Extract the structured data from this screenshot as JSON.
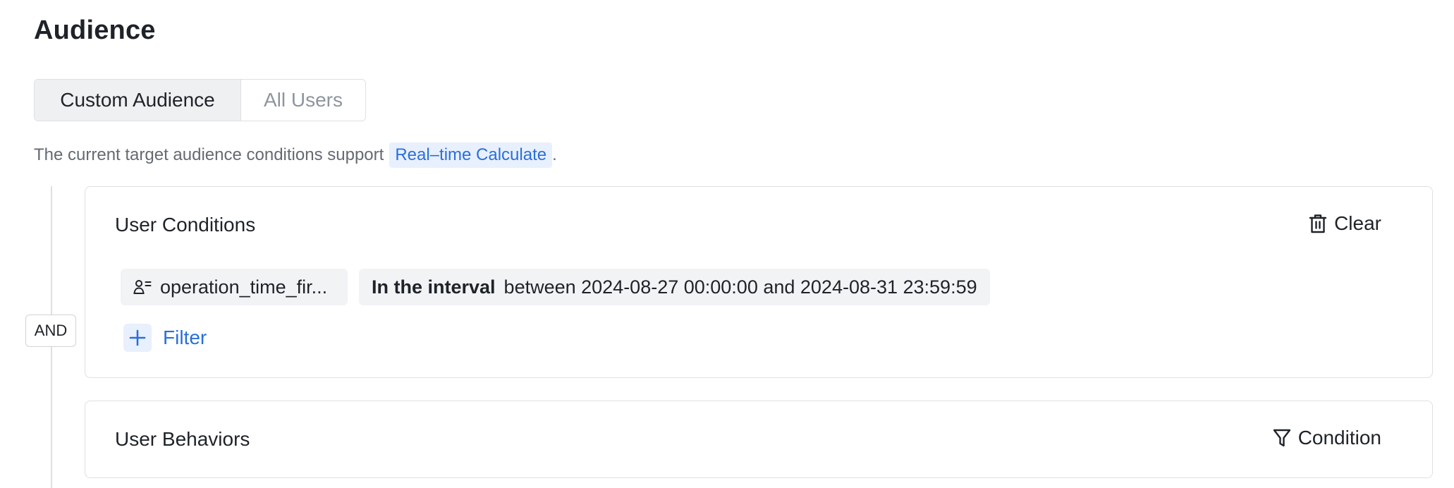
{
  "page": {
    "title": "Audience"
  },
  "segments": {
    "items": [
      {
        "label": "Custom Audience",
        "active": true
      },
      {
        "label": "All Users",
        "active": false
      }
    ]
  },
  "hint": {
    "text": "The current target audience conditions support",
    "tag": "Real–time Calculate",
    "suffix": "."
  },
  "logic": {
    "operator": "AND"
  },
  "user_conditions": {
    "title": "User Conditions",
    "clear_label": "Clear",
    "condition": {
      "attribute_icon": "user-attribute-icon",
      "attribute": "operation_time_fir...",
      "operator": "In the interval",
      "value": "between 2024-08-27 00:00:00 and 2024-08-31 23:59:59"
    },
    "add_filter_label": "Filter"
  },
  "user_behaviors": {
    "title": "User Behaviors",
    "condition_label": "Condition"
  },
  "colors": {
    "accent": "#2a6fdb",
    "accent_bg": "#e8f0fd",
    "chip_bg": "#f2f3f5",
    "border": "#dee0e3",
    "text": "#1f2329",
    "muted": "#646a73"
  }
}
